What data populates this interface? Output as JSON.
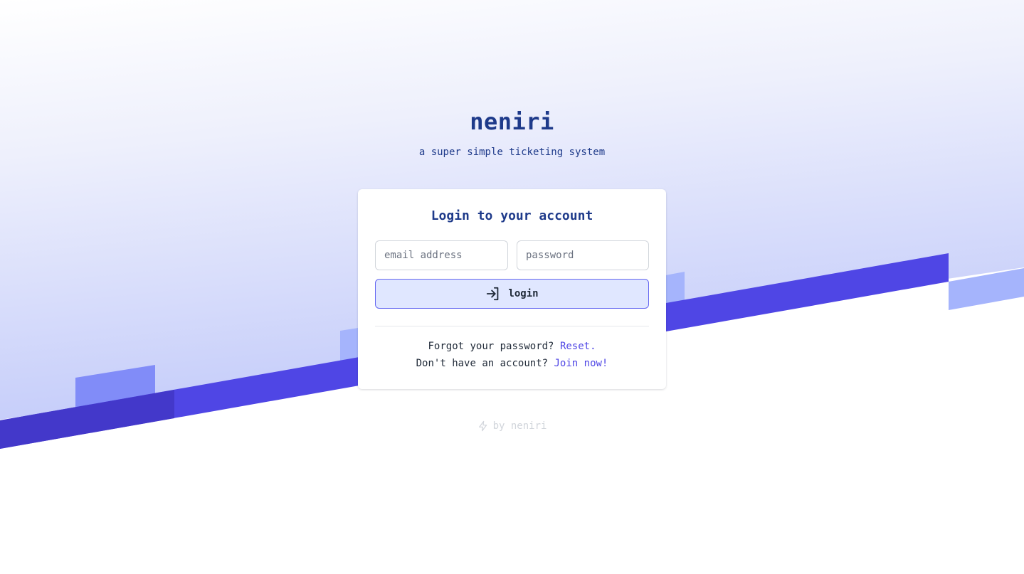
{
  "brand": {
    "name": "neniri",
    "tagline": "a super simple ticketing system"
  },
  "login_card": {
    "title": "Login to your account",
    "email_placeholder": "email address",
    "password_placeholder": "password",
    "login_label": "login",
    "login_icon": "login-arrow-icon",
    "forgot_prompt": "Forgot your password?",
    "forgot_link": "Reset.",
    "signup_prompt": "Don't have an account?",
    "signup_link": "Join now!"
  },
  "footer": {
    "text": "by neniri",
    "icon": "lightning-bolt-icon"
  },
  "colors": {
    "brand_text": "#1e3a8a",
    "accent": "#4f46e5",
    "button_bg": "#e0e7ff",
    "band_dark": "#4f46e5",
    "band_light": "#a5b4fc"
  }
}
